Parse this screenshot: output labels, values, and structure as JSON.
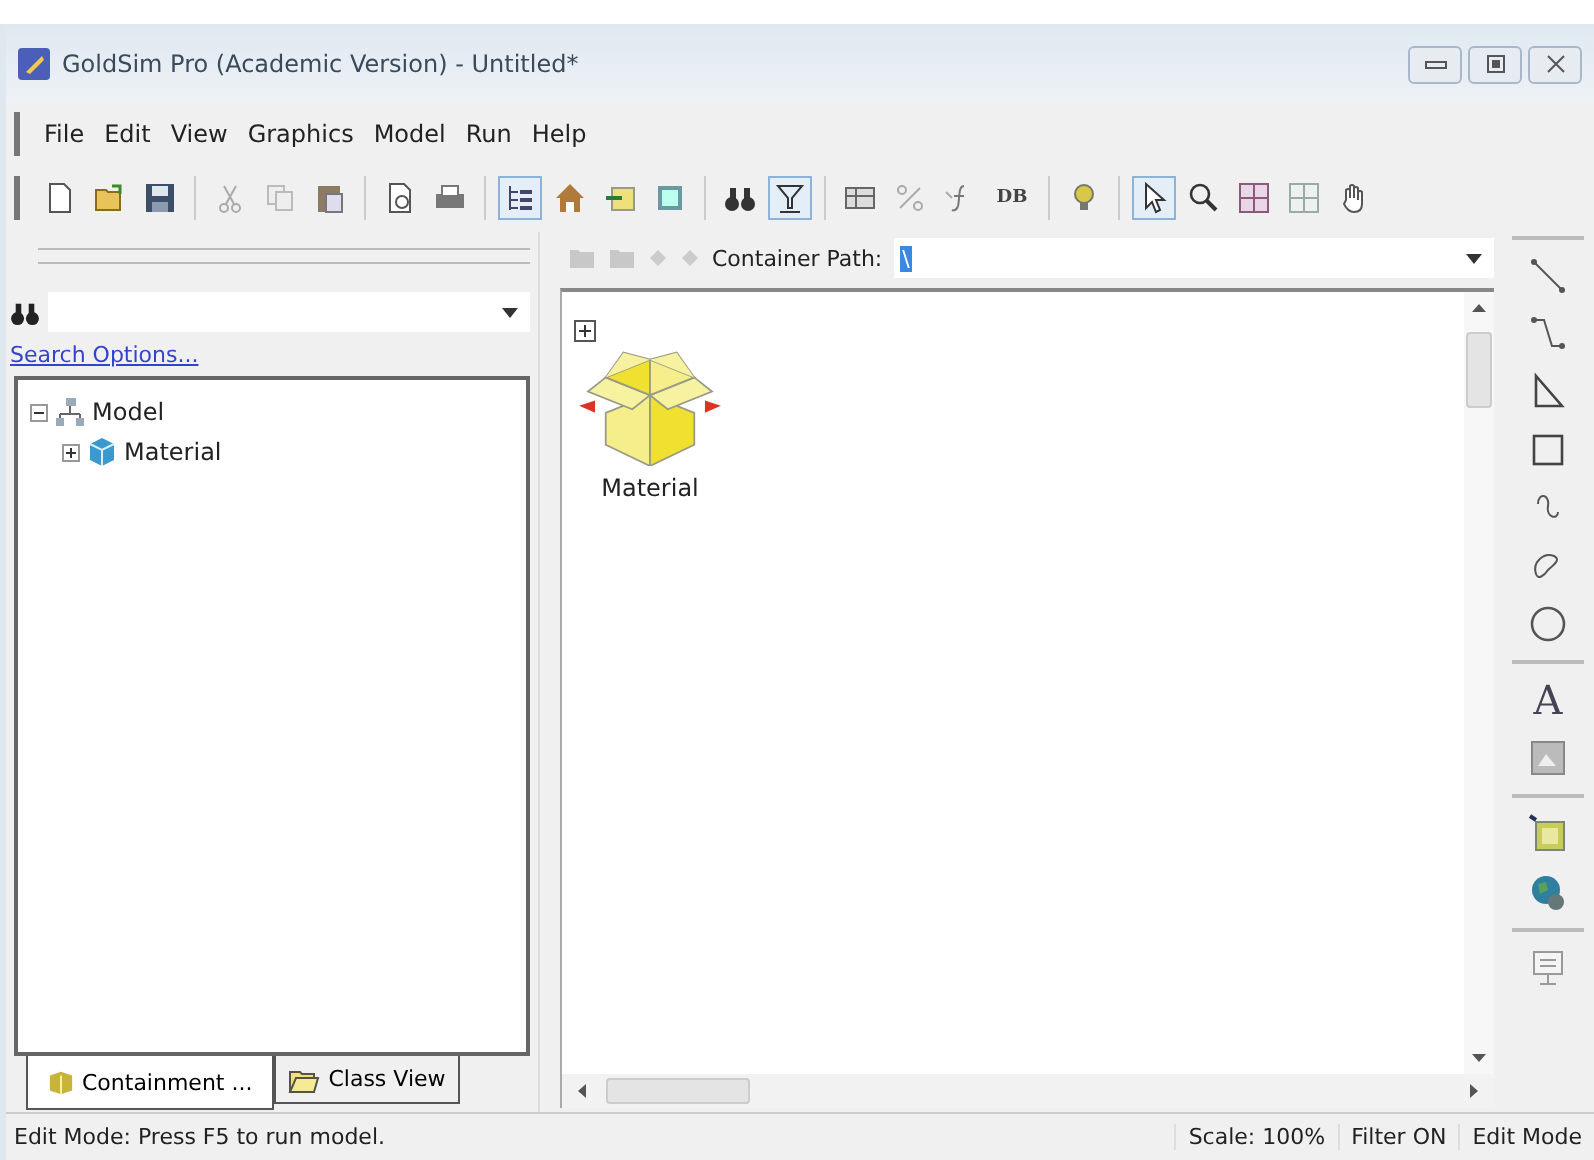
{
  "window": {
    "title": "GoldSim Pro (Academic Version) - Untitled*"
  },
  "menu": [
    "File",
    "Edit",
    "View",
    "Graphics",
    "Model",
    "Run",
    "Help"
  ],
  "toolbar": [
    {
      "kind": "new",
      "selected": false
    },
    {
      "kind": "open",
      "selected": false
    },
    {
      "kind": "save",
      "selected": false
    },
    {
      "kind": "separator"
    },
    {
      "kind": "cut",
      "selected": false
    },
    {
      "kind": "copy",
      "selected": false
    },
    {
      "kind": "paste",
      "selected": false
    },
    {
      "kind": "separator"
    },
    {
      "kind": "preview",
      "selected": false
    },
    {
      "kind": "print",
      "selected": false
    },
    {
      "kind": "separator"
    },
    {
      "kind": "tree",
      "selected": true
    },
    {
      "kind": "house",
      "selected": false
    },
    {
      "kind": "import",
      "selected": false
    },
    {
      "kind": "panel",
      "selected": false
    },
    {
      "kind": "separator"
    },
    {
      "kind": "binoculars",
      "selected": false
    },
    {
      "kind": "filter",
      "selected": true
    },
    {
      "kind": "separator"
    },
    {
      "kind": "table",
      "selected": false
    },
    {
      "kind": "percent",
      "selected": false
    },
    {
      "kind": "function",
      "selected": false
    },
    {
      "kind": "text",
      "label": "DB",
      "selected": false
    },
    {
      "kind": "separator"
    },
    {
      "kind": "bulb",
      "selected": false
    },
    {
      "kind": "separator"
    },
    {
      "kind": "pointer",
      "selected": true
    },
    {
      "kind": "zoom",
      "selected": false
    },
    {
      "kind": "grid",
      "selected": false
    },
    {
      "kind": "grid-faint",
      "selected": false
    },
    {
      "kind": "hand",
      "selected": false
    }
  ],
  "sidebar": {
    "search_options": "Search Options...",
    "tree": [
      {
        "label": "Model",
        "kind": "model",
        "expanded": true,
        "children": [
          {
            "label": "Material",
            "kind": "container",
            "expanded": false
          }
        ]
      }
    ],
    "tabs": [
      {
        "label": "Containment ...",
        "selected": true
      },
      {
        "label": "Class View",
        "selected": false
      }
    ]
  },
  "canvas": {
    "path_label": "Container Path:",
    "path_value": "\\",
    "elements": [
      {
        "label": "Material",
        "kind": "container"
      }
    ]
  },
  "tools": [
    {
      "kind": "line"
    },
    {
      "kind": "elbow"
    },
    {
      "kind": "triangle"
    },
    {
      "kind": "rectangle"
    },
    {
      "kind": "curve"
    },
    {
      "kind": "blob"
    },
    {
      "kind": "ellipse"
    },
    {
      "kind": "separator"
    },
    {
      "kind": "text",
      "label": "A"
    },
    {
      "kind": "image"
    },
    {
      "kind": "separator"
    },
    {
      "kind": "picture"
    },
    {
      "kind": "globe"
    },
    {
      "kind": "separator"
    },
    {
      "kind": "display"
    }
  ],
  "status_bar": {
    "message": "Edit Mode: Press F5 to run model.",
    "panes": [
      "Scale: 100%",
      "Filter ON",
      "Edit Mode"
    ]
  }
}
